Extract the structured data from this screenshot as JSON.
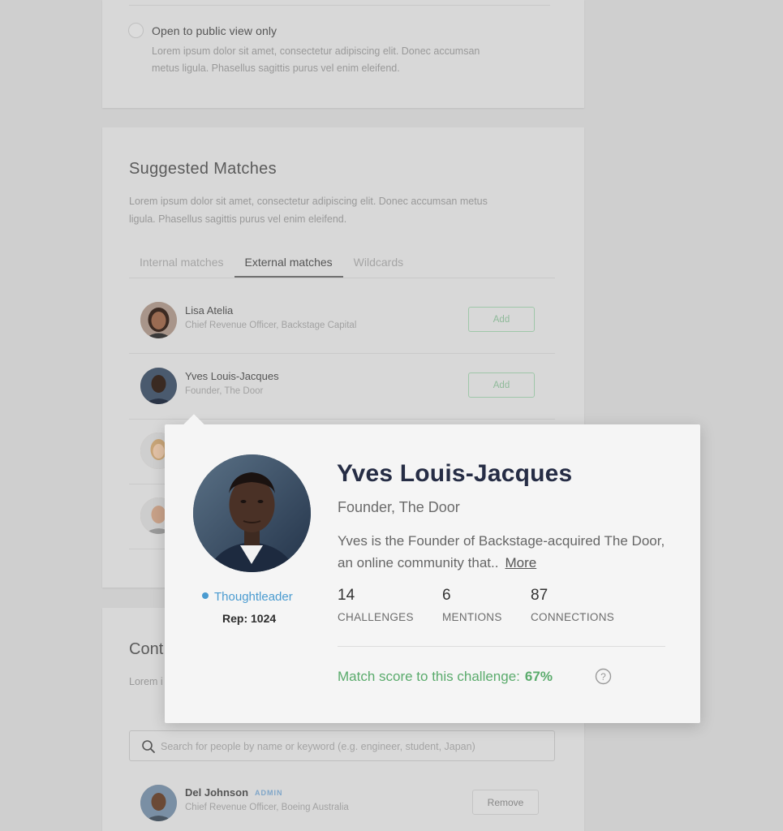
{
  "visibility_option": {
    "label": "Open to public view only",
    "description": "Lorem ipsum dolor sit amet, consectetur adipiscing elit. Donec accumsan metus ligula. Phasellus sagittis purus vel enim eleifend."
  },
  "suggested_matches": {
    "title": "Suggested Matches",
    "description": "Lorem ipsum dolor sit amet, consectetur adipiscing elit. Donec accumsan metus ligula. Phasellus sagittis purus vel enim eleifend.",
    "tabs": [
      {
        "label": "Internal matches",
        "active": false
      },
      {
        "label": "External matches",
        "active": true
      },
      {
        "label": "Wildcards",
        "active": false
      }
    ],
    "items": [
      {
        "name": "Lisa Atelia",
        "role": "Chief Revenue Officer, Backstage Capital",
        "button": "Add"
      },
      {
        "name": "Yves Louis-Jacques",
        "role": "Founder, The Door",
        "button": "Add"
      }
    ]
  },
  "contacts": {
    "title": "Cont",
    "description": "Lorem i ligula. P",
    "search_placeholder": "Search for people by name or keyword (e.g. engineer, student, Japan)",
    "items": [
      {
        "name": "Del Johnson",
        "badge": "ADMIN",
        "role": "Chief Revenue Officer, Boeing Australia",
        "button": "Remove"
      }
    ]
  },
  "profile_popover": {
    "name": "Yves Louis-Jacques",
    "role": "Founder, The Door",
    "bio": "Yves is the Founder of Backstage-acquired The Door, an online community that..",
    "more_label": "More",
    "tag": "Thoughtleader",
    "rep": "Rep: 1024",
    "stats": [
      {
        "value": "14",
        "label": "CHALLENGES"
      },
      {
        "value": "6",
        "label": "MENTIONS"
      },
      {
        "value": "87",
        "label": "CONNECTIONS"
      }
    ],
    "match_score_label": "Match score to this challenge:",
    "match_score_value": "67%"
  },
  "colors": {
    "accent_blue": "#4a9bd0",
    "accent_green": "#5aab6c",
    "name_navy": "#262d45"
  }
}
